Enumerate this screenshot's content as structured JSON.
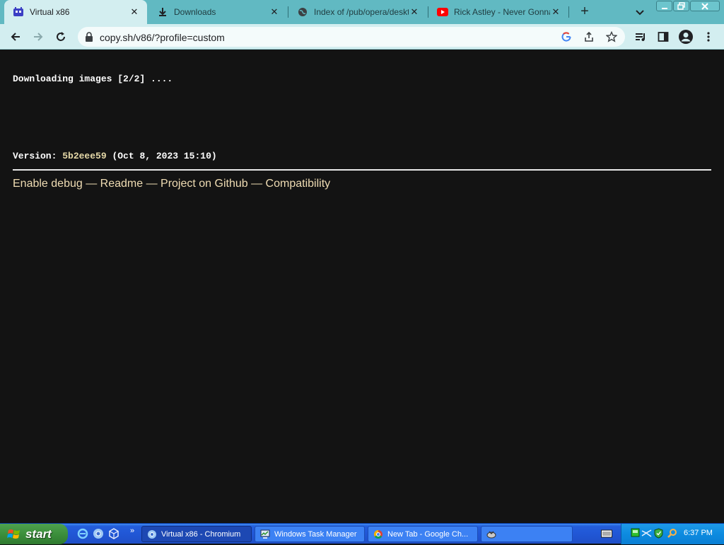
{
  "browser": {
    "tabs": [
      {
        "title": "Virtual x86",
        "active": true,
        "icon": "v86-icon"
      },
      {
        "title": "Downloads",
        "active": false,
        "icon": "download-icon"
      },
      {
        "title": "Index of /pub/opera/deskto",
        "active": false,
        "icon": "globe-icon"
      },
      {
        "title": "Rick Astley - Never Gonna G",
        "active": false,
        "icon": "youtube-icon"
      }
    ],
    "url": "copy.sh/v86/?profile=custom"
  },
  "page": {
    "status": "Downloading images [2/2] ....",
    "version_label": "Version: ",
    "version_hash": "5b2eee59",
    "version_date": " (Oct 8, 2023 15:10)",
    "links": [
      {
        "label": "Enable debug"
      },
      {
        "label": "Readme"
      },
      {
        "label": "Project on Github"
      },
      {
        "label": "Compatibility"
      }
    ],
    "separator": " — "
  },
  "taskbar": {
    "start_label": "start",
    "windows": [
      {
        "label": "Virtual x86 - Chromium",
        "active": true
      },
      {
        "label": "Windows Task Manager",
        "active": false
      },
      {
        "label": "New Tab - Google Ch...",
        "active": false
      },
      {
        "label": "",
        "active": false
      }
    ],
    "clock": "6:37 PM"
  },
  "colors": {
    "tabstrip": "#61b9c2",
    "toolbar": "#d3eef0",
    "page_bg": "#131313",
    "link": "#efdcb3",
    "hash": "#e6d9a8"
  }
}
